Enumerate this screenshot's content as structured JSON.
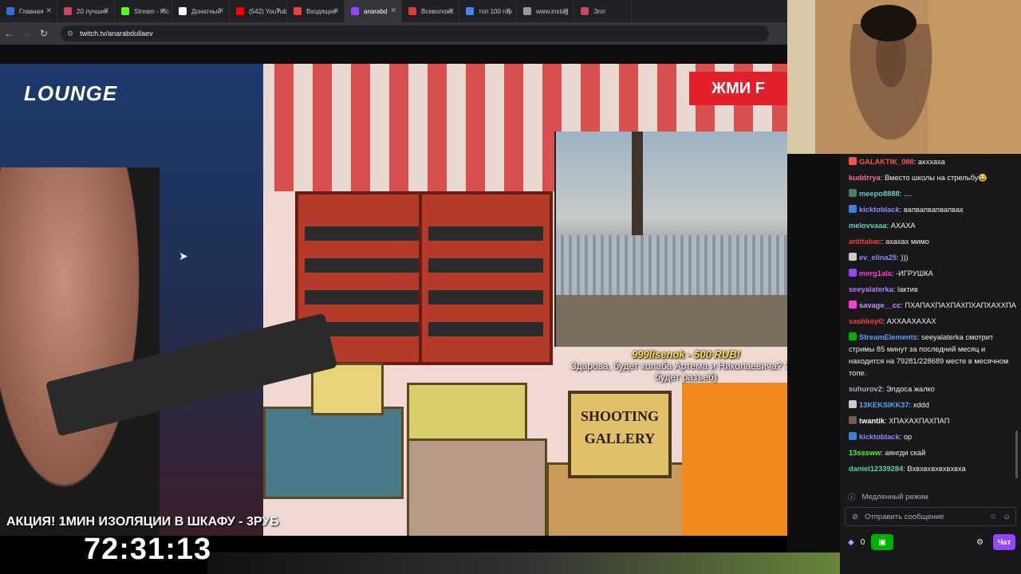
{
  "browser": {
    "tabs": [
      {
        "label": "Главная",
        "color": "#2f6fd6"
      },
      {
        "label": "20 лучших",
        "color": "#c9465e"
      },
      {
        "label": "Stream - Kic",
        "color": "#53fc18"
      },
      {
        "label": "Донатный",
        "color": "#ffffff"
      },
      {
        "label": "(542) YouTub",
        "color": "#ff0000"
      },
      {
        "label": "Входящие",
        "color": "#ea4335"
      },
      {
        "label": "anarabd",
        "color": "#9147ff"
      },
      {
        "label": "Всеволожс",
        "color": "#e53935"
      },
      {
        "label": "топ 100 гор",
        "color": "#4285f4"
      },
      {
        "label": "www.instag",
        "color": "#999999"
      },
      {
        "label": "Элл",
        "color": "#c9465e"
      }
    ],
    "url": "twitch.tv/anarabdullaev"
  },
  "video": {
    "brand_logo": "LOUNGE",
    "jmi_banner": "ЖМИ F",
    "donation_user": "999lisenok - 500 RUB!",
    "donation_text": "Здарова, будет колаба Артема и Николаевича? Это будет разъеб)",
    "promo": "АКЦИЯ! 1МИН ИЗОЛЯЦИИ В ШКАФУ - 3РУБ",
    "timer": "72:31:13",
    "sign_line1": "SHOOTING",
    "sign_line2": "GALLERY"
  },
  "chat": {
    "messages": [
      {
        "user": "GALAKTIK_088",
        "text": "ахххаха",
        "color": "#ff4f4f",
        "badge": "#ff4f4f"
      },
      {
        "user": "kuddrrya",
        "text": "Вместо школы на стрельбу😂",
        "color": "#ff6b8b",
        "badge": ""
      },
      {
        "user": "meepo8888",
        "text": "....",
        "color": "#5fd0b8",
        "badge": "#4a7d6a"
      },
      {
        "user": "kicktoblack",
        "text": "вапвапвапвапвах",
        "color": "#8b8bff",
        "badge": "#3f7fd4"
      },
      {
        "user": "melovvaaa",
        "text": "АХАХА",
        "color": "#5fd0b8",
        "badge": ""
      },
      {
        "user": "antitabac",
        "text": "ахахах мимо",
        "color": "#ff3b3b",
        "badge": ""
      },
      {
        "user": "ev_elina25",
        "text": ")))",
        "color": "#8b8bff",
        "badge": "#cccccc"
      },
      {
        "user": "merg1ala",
        "text": "-ИГРУШКА",
        "color": "#ff3bdc",
        "badge": "#9147ff"
      },
      {
        "user": "seeyalaterka",
        "text": "lактив",
        "color": "#b57aff",
        "badge": ""
      },
      {
        "user": "savage__cc",
        "text": "ПХАПАХПАХПАХПХАПХАХХПА",
        "color": "#d48bff",
        "badge": "#ff3bdc"
      },
      {
        "user": "sashkoy0",
        "text": "АХХААХАХАХ",
        "color": "#ff3b3b",
        "badge": ""
      },
      {
        "user": "StreamElements",
        "text": "seeyalaterka смотрит стримы 85 минут за последний месяц и находится на 79281/228689 месте в месячном топе.",
        "color": "#5aa0ff",
        "badge": "#00ad03"
      },
      {
        "user": "suhurov2",
        "text": "Элдоса жалко",
        "color": "#adadb8",
        "badge": ""
      },
      {
        "user": "13KEKSIKK37",
        "text": "xddd",
        "color": "#5aa0ff",
        "badge": "#cccccc"
      },
      {
        "user": "twantik",
        "text": "ХПАХАХПАХПАП",
        "color": "#ffffff",
        "badge": "#7a5a4a"
      },
      {
        "user": "kicktoblack",
        "text": "ор",
        "color": "#8b8bff",
        "badge": "#3f7fd4"
      },
      {
        "user": "13sssww",
        "text": "аянгди скай",
        "color": "#53fc18",
        "badge": ""
      },
      {
        "user": "daniel12339284",
        "text": "Вхвхвхвхвхвхвха",
        "color": "#5fd0b8",
        "badge": ""
      }
    ],
    "slow_mode": "Медленный режим",
    "send_placeholder": "Отправить сообщение",
    "points": "0",
    "chat_button": "Чат"
  }
}
